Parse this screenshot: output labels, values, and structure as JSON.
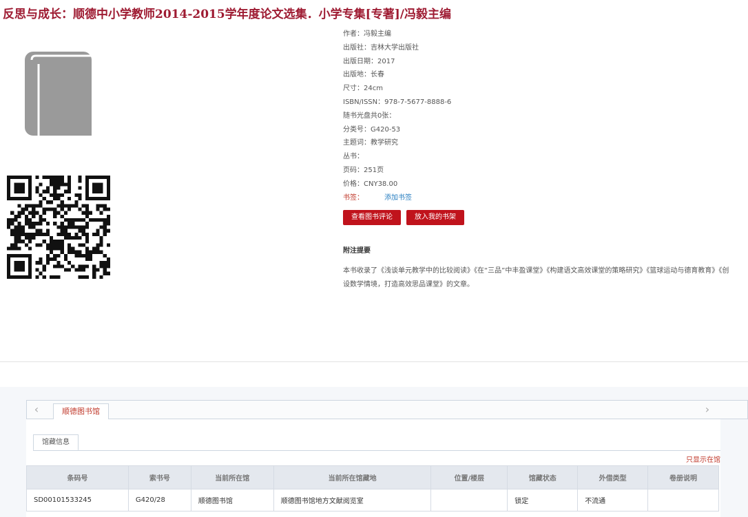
{
  "page": {
    "title": "反思与成长：顺德中小学教师2014-2015学年度论文选集．小学专集[专著]/冯毅主编"
  },
  "meta": [
    {
      "key": "作者：",
      "value": "冯毅主编"
    },
    {
      "key": "出版社：",
      "value": "吉林大学出版社"
    },
    {
      "key": "出版日期：",
      "value": "2017"
    },
    {
      "key": "出版地：",
      "value": "长春"
    },
    {
      "key": "尺寸：",
      "value": "24cm"
    },
    {
      "key": "ISBN/ISSN：",
      "value": "978-7-5677-8888-6"
    },
    {
      "key": "随书光盘共0张：",
      "value": ""
    },
    {
      "key": "分类号：",
      "value": "G420-53"
    },
    {
      "key": "主题词：",
      "value": "教学研究"
    },
    {
      "key": "丛书：",
      "value": ""
    },
    {
      "key": "页码：",
      "value": "251页"
    },
    {
      "key": "价格：",
      "value": "CNY38.00"
    }
  ],
  "bookmark": {
    "key": "书签：",
    "link": "添加书签"
  },
  "buttons": {
    "review": "查看图书评论",
    "shelf": "放入我的书架"
  },
  "notes": {
    "heading": "附注提要",
    "body": "本书收录了《浅谈单元教学中的比较阅读》《在“三品”中丰盈课堂》《构建语文高效课堂的策略研究》《篮球运动与德育教育》《创设数学情境，打造高效思品课堂》的文章。"
  },
  "tabs": {
    "library": "顺德图书馆",
    "holdings": "馆藏信息",
    "prev_icon": "chevron-left-icon",
    "next_icon": "chevron-right-icon"
  },
  "only_show": "只显示在馆",
  "table": {
    "headers": [
      "条码号",
      "索书号",
      "当前所在馆",
      "当前所在馆藏地",
      "位置/楼层",
      "馆藏状态",
      "外借类型",
      "卷册说明"
    ],
    "rows": [
      [
        "SD00101533245",
        "G420/28",
        "顺德图书馆",
        "顺德图书馆地方文献阅览室",
        "",
        "锁定",
        "不流通",
        ""
      ]
    ]
  },
  "colors": {
    "title": "#9e1b32",
    "button": "#c0131c",
    "link": "#2a7fc1",
    "accent_red": "#c0392b"
  },
  "icons": [
    "book-icon",
    "qr-code-icon",
    "chevron-left-icon",
    "chevron-right-icon"
  ]
}
